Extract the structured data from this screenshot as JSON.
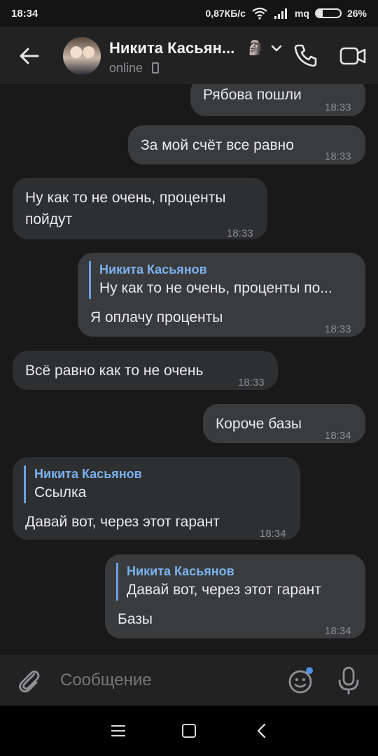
{
  "status_bar": {
    "time": "18:34",
    "speed": "0,87КБ/с",
    "carrier": "mq",
    "battery": "26%",
    "battery_level": 0.26
  },
  "header": {
    "contact_name": "Никита Касьян...",
    "emoji": "🗿",
    "status": "online"
  },
  "messages": [
    {
      "dir": "out",
      "text": "Рябова пошли",
      "time": "18:33"
    },
    {
      "dir": "out",
      "text": "За мой счёт все равно",
      "time": "18:33"
    },
    {
      "dir": "in",
      "lines": [
        "Ну как то не очень, проценты",
        "пойдут"
      ],
      "time": "18:33"
    },
    {
      "dir": "out",
      "reply": {
        "name": "Никита Касьянов",
        "text": "Ну как то не очень, проценты по..."
      },
      "text": "Я оплачу проценты",
      "time": "18:33"
    },
    {
      "dir": "in",
      "text": "Всё равно как то не очень",
      "time": "18:33"
    },
    {
      "dir": "out",
      "text": "Короче базы",
      "time": "18:34"
    },
    {
      "dir": "in",
      "reply": {
        "name": "Никита Касьянов",
        "text": "Ссылка"
      },
      "text": "Давай вот, через этот гарант",
      "time": "18:34"
    },
    {
      "dir": "out",
      "reply": {
        "name": "Никита Касьянов",
        "text": "Давай вот, через этот гарант"
      },
      "text": "Базы",
      "time": "18:34"
    }
  ],
  "composer": {
    "placeholder": "Сообщение"
  },
  "colors": {
    "accent": "#6aa1e6",
    "background": "#19191a",
    "bubble_out": "#3a3b3d",
    "bubble_in": "#2e2f31"
  },
  "icons": [
    "back-arrow-icon",
    "chevron-down-icon",
    "phone-icon",
    "video-camera-icon",
    "paperclip-icon",
    "emoji-icon",
    "microphone-icon",
    "wifi-icon",
    "signal-icon",
    "battery-icon",
    "nav-menu-icon",
    "nav-home-icon",
    "nav-back-icon"
  ]
}
